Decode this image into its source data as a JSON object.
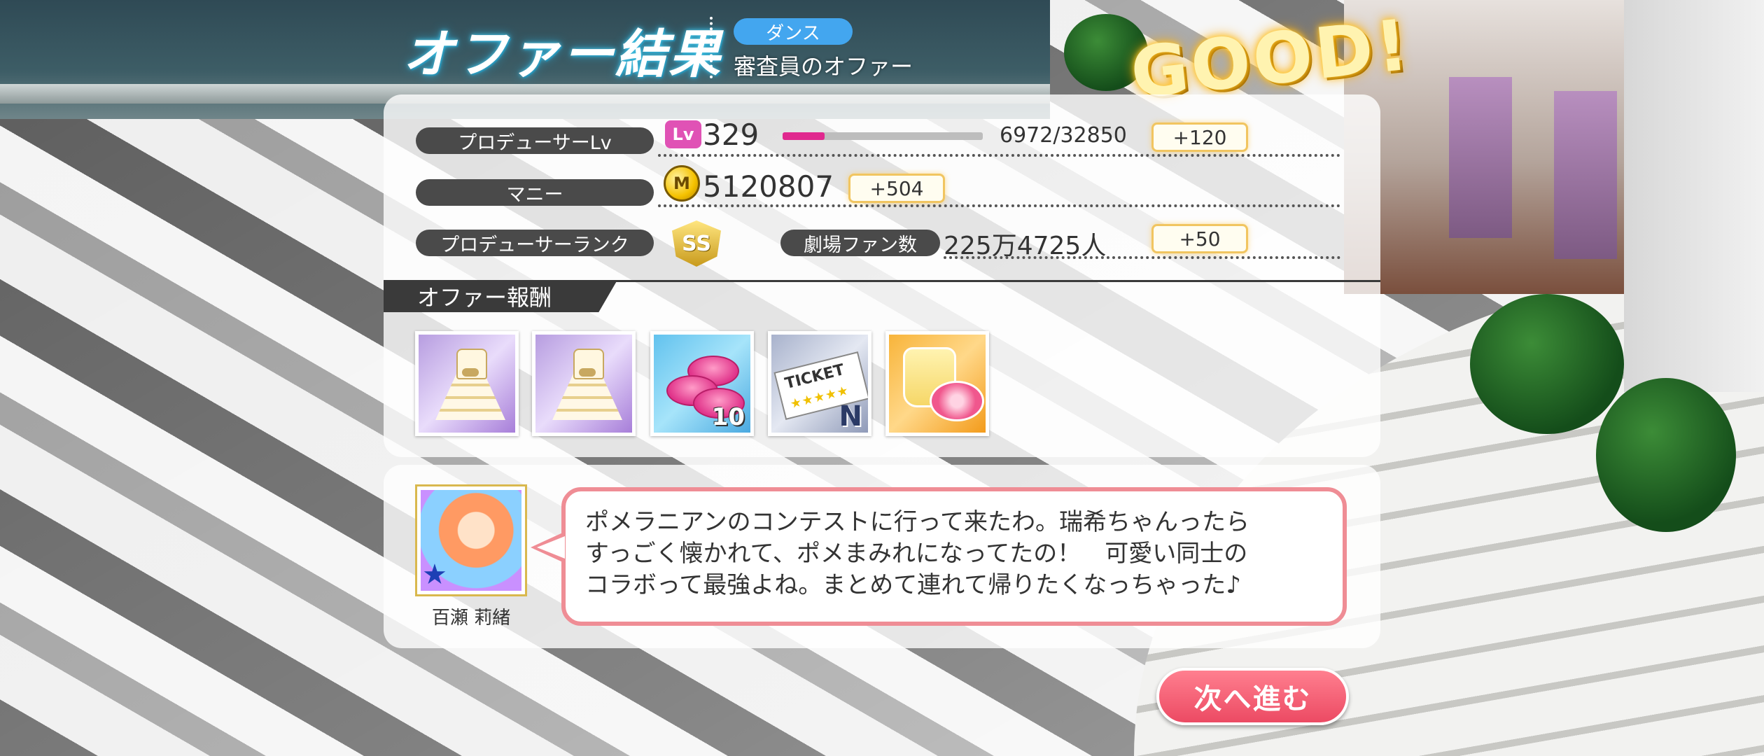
{
  "header": {
    "title": "オファー結果",
    "genre": "ダンス",
    "subtitle": "審査員のオファー",
    "result": "GOOD!"
  },
  "stats": {
    "producer_lv": {
      "label": "プロデューサーLv",
      "icon": "Lv",
      "level": "329",
      "exp": "6972/32850",
      "exp_fraction": 0.21,
      "bonus": "+120"
    },
    "money": {
      "label": "マニー",
      "value": "5120807",
      "bonus": "+504"
    },
    "rank": {
      "label": "プロデューサーランク",
      "icon_text": "SS"
    },
    "fans": {
      "label": "劇場ファン数",
      "value": "225万4725人",
      "bonus": "+50"
    }
  },
  "rewards": {
    "header": "オファー報酬",
    "items": [
      {
        "icon": "white-dress-costume-icon"
      },
      {
        "icon": "white-dress-costume-icon"
      },
      {
        "icon": "pink-coins-icon",
        "quantity": "10"
      },
      {
        "icon": "ticket-icon",
        "ticket_text": "TICKET",
        "rarity": "N"
      },
      {
        "icon": "pudding-macaron-icon"
      }
    ]
  },
  "dialog": {
    "character_name": "百瀬 莉緒",
    "lines": [
      "ポメラニアンのコンテストに行って来たわ。瑞希ちゃんったら",
      "すっごく懐かれて、ポメまみれになってたの！　可愛い同士の",
      "コラボって最強よね。まとめて連れて帰りたくなっちゃった♪"
    ]
  },
  "next_button": "次へ進む",
  "colors": {
    "accent_pink": "#ec4a63",
    "exp_bar": "#e0288e",
    "genre_blue": "#43a6ef",
    "bubble_border": "#ef8d95"
  }
}
